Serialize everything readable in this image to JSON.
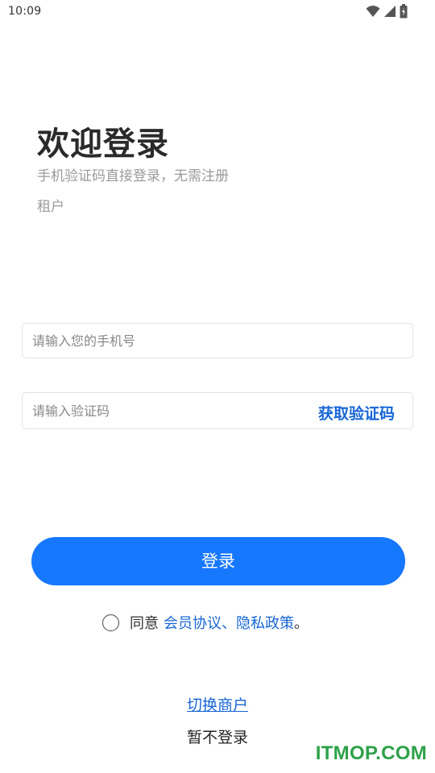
{
  "status_bar": {
    "time": "10:09",
    "icons": [
      "wifi-icon",
      "signal-icon",
      "battery-icon"
    ]
  },
  "header": {
    "title": "欢迎登录",
    "subtitle": "手机验证码直接登录，无需注册",
    "tenant_label": "租户"
  },
  "form": {
    "phone_placeholder": "请输入您的手机号",
    "code_placeholder": "请输入验证码",
    "get_code_label": "获取验证码"
  },
  "login_button_label": "登录",
  "agreement": {
    "prefix": "同意",
    "member_agreement": "会员协议",
    "separator": "、",
    "privacy_policy": "隐私政策",
    "suffix": "。",
    "checked": false
  },
  "footer": {
    "switch_tenant": "切换商户",
    "skip_login": "暂不登录"
  },
  "watermark": "ITMOP.COM",
  "colors": {
    "primary": "#1677ff",
    "link": "#1766d6",
    "watermark": "#2ea14a"
  }
}
